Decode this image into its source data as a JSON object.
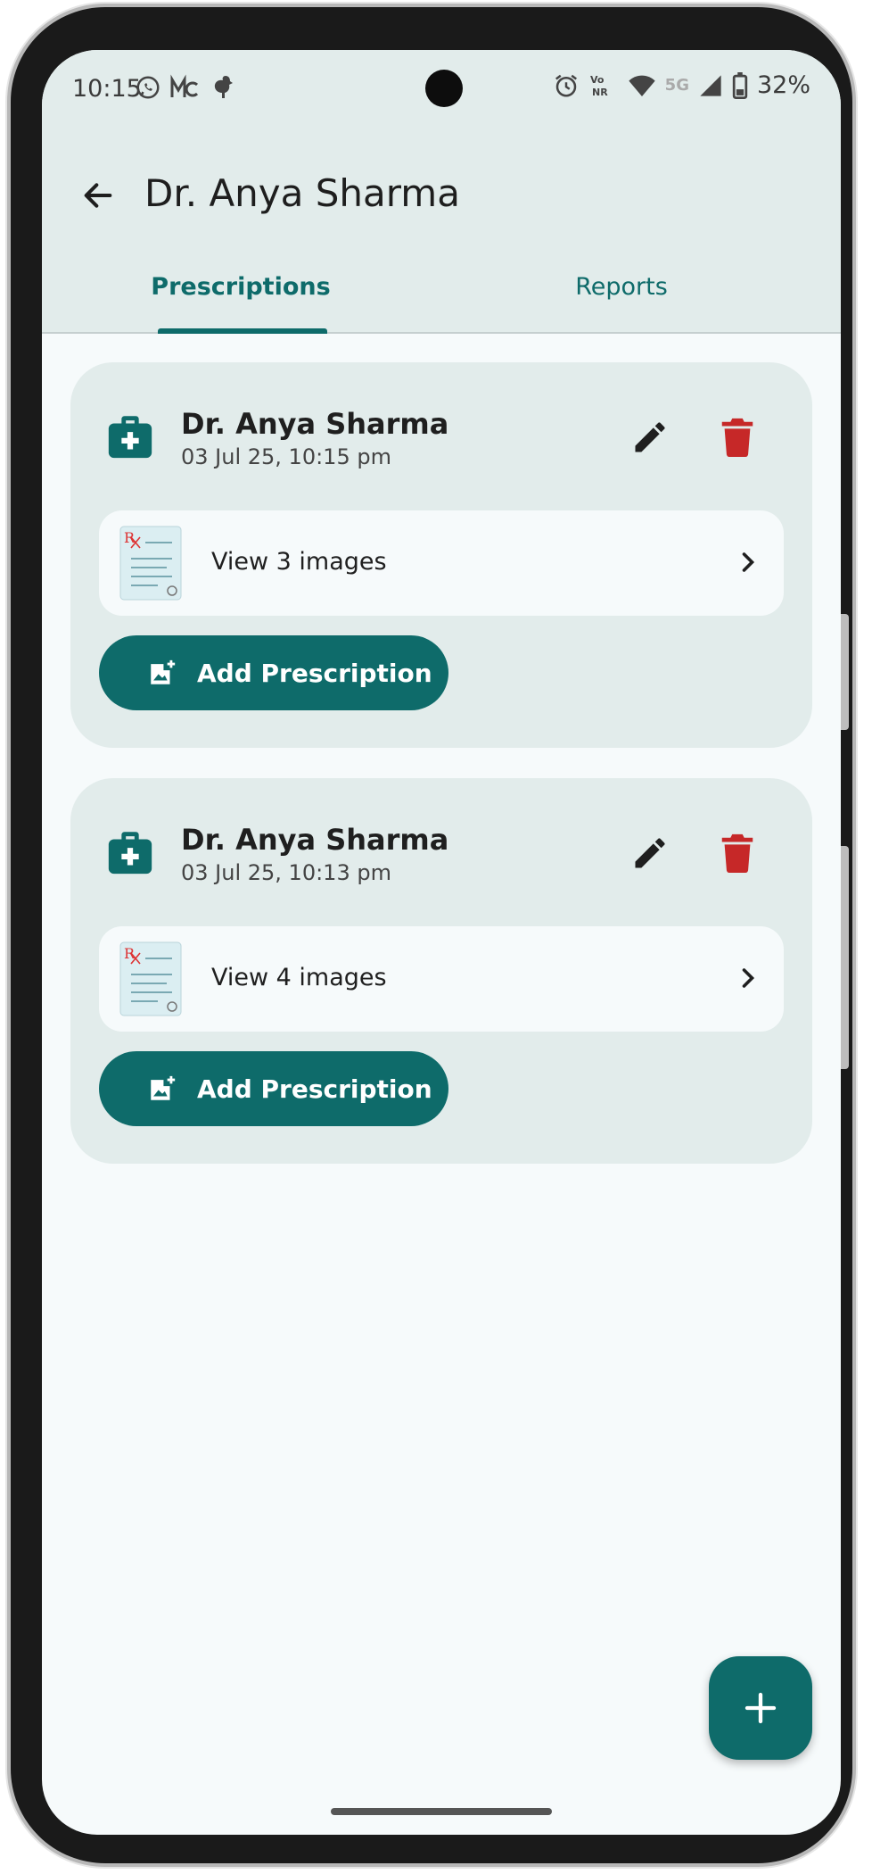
{
  "status_bar": {
    "time": "10:15",
    "battery": "32%",
    "network": "5G",
    "vo_label": "Vo",
    "nr_label": "NR"
  },
  "app_bar": {
    "title": "Dr. Anya Sharma"
  },
  "tabs": [
    {
      "label": "Prescriptions",
      "selected": true
    },
    {
      "label": "Reports",
      "selected": false
    }
  ],
  "prescriptions": [
    {
      "doctor": "Dr. Anya Sharma",
      "datetime": "03 Jul 25, 10:15 pm",
      "view_label": "View 3 images",
      "add_label": "Add Prescription"
    },
    {
      "doctor": "Dr. Anya Sharma",
      "datetime": "03 Jul 25, 10:13 pm",
      "view_label": "View 4 images",
      "add_label": "Add Prescription"
    }
  ],
  "icons": {
    "back": "arrow-left-icon",
    "kit": "medical-kit-icon",
    "edit": "pencil-icon",
    "delete": "trash-icon",
    "thumbnail": "prescription-document-icon",
    "chevron": "chevron-right-icon",
    "add_photo": "add-photo-icon",
    "fab": "plus-icon"
  },
  "colors": {
    "primary": "#0e6b6a",
    "delete": "#c62828",
    "surface": "#e2eceb",
    "background": "#f6fafb"
  }
}
